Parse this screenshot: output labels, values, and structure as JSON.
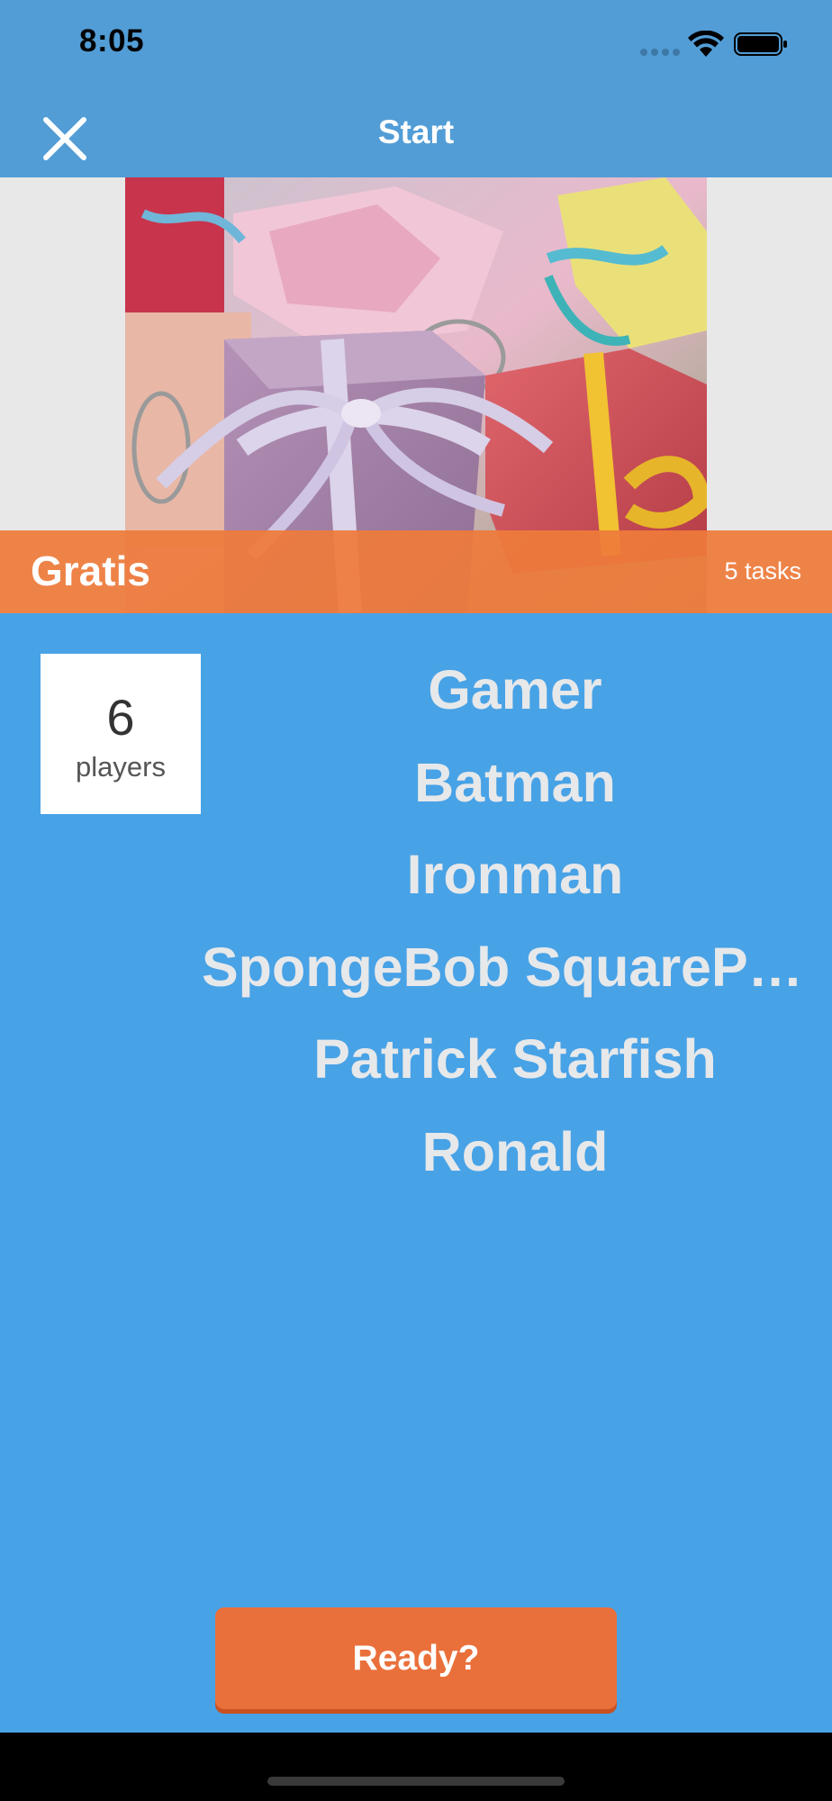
{
  "status_bar": {
    "time": "8:05"
  },
  "nav": {
    "title": "Start",
    "close_icon": "close-icon"
  },
  "hero": {
    "image_subject": "pile of wrapped gift boxes with ribbons"
  },
  "category": {
    "title": "Gratis",
    "task_count": "5 tasks"
  },
  "players": {
    "count": "6",
    "label": "players",
    "names": [
      "Gamer",
      "Batman",
      "Ironman",
      "SpongeBob SquarePants",
      "Patrick Starfish",
      "Ronald"
    ]
  },
  "ready_button": {
    "label": "Ready?"
  },
  "colors": {
    "background": "#48A2E6",
    "nav_bar": "#529DD6",
    "accent_orange": "#EA703B",
    "name_text": "#E6E8EA"
  }
}
